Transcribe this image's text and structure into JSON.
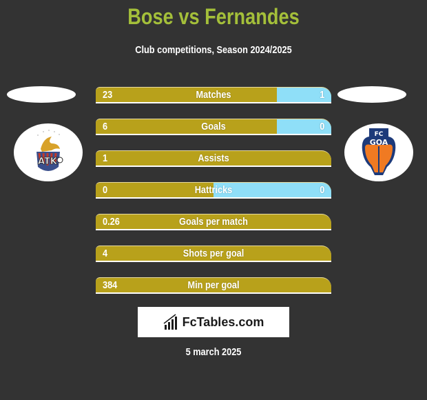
{
  "header": {
    "title": "Bose vs Fernandes",
    "subtitle": "Club competitions, Season 2024/2025"
  },
  "players": {
    "left": {
      "name": "Bose",
      "club_logo": "atk-logo"
    },
    "right": {
      "name": "Fernandes",
      "club_logo": "fc-goa-logo"
    }
  },
  "colors": {
    "title": "#a4bf3a",
    "left_bar": "#b8a11b",
    "right_bar": "#8fdff8",
    "background": "#333333"
  },
  "stats": [
    {
      "label": "Matches",
      "left": "23",
      "right": "1",
      "right_share": 0.23
    },
    {
      "label": "Goals",
      "left": "6",
      "right": "0",
      "right_share": 0.23
    },
    {
      "label": "Assists",
      "left": "1",
      "right": "",
      "right_share": 0
    },
    {
      "label": "Hattricks",
      "left": "0",
      "right": "0",
      "right_share": 0.5
    },
    {
      "label": "Goals per match",
      "left": "0.26",
      "right": "",
      "right_share": 0
    },
    {
      "label": "Shots per goal",
      "left": "4",
      "right": "",
      "right_share": 0
    },
    {
      "label": "Min per goal",
      "left": "384",
      "right": "",
      "right_share": 0
    }
  ],
  "footer": {
    "brand": "FcTables.com",
    "date": "5 march 2025"
  }
}
